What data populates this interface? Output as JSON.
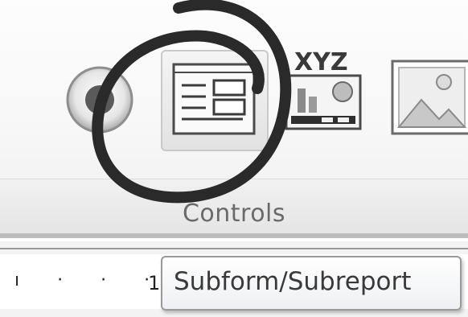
{
  "ribbon": {
    "group_label": "Controls",
    "controls": [
      {
        "name": "option-button",
        "icon": "radio-button-icon"
      },
      {
        "name": "subform-subreport",
        "icon": "subform-icon"
      },
      {
        "name": "field-list",
        "icon": "xyz-field-icon",
        "label": "XYZ"
      },
      {
        "name": "image",
        "icon": "image-icon"
      }
    ]
  },
  "ruler": {
    "marks": "ı · · · ·",
    "number": "1"
  },
  "tooltip": {
    "text": "Subform/Subreport"
  },
  "colors": {
    "annotation": "#2a2a2a",
    "tooltip_border": "#9a9a9a",
    "group_label": "#6a6a6a"
  }
}
